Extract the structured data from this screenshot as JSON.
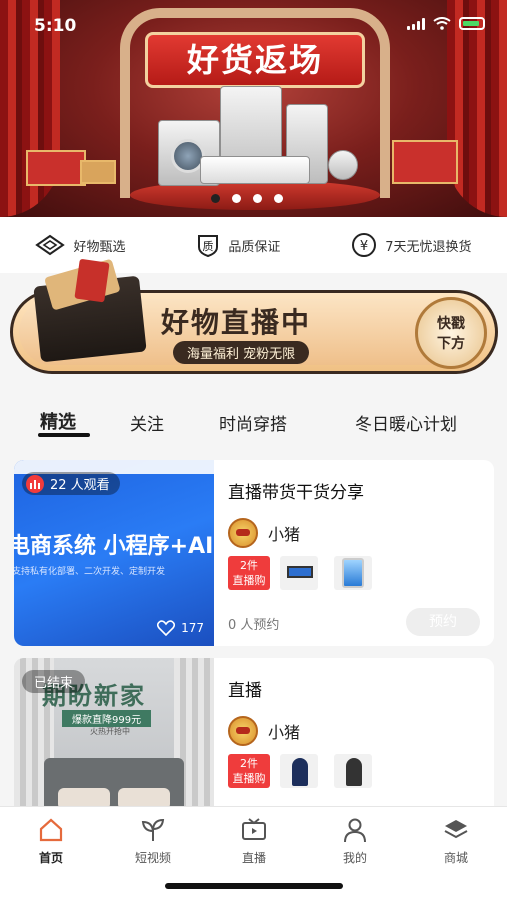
{
  "status_bar": {
    "time": "5:10"
  },
  "hero": {
    "title": "好货返场",
    "dots_total": 4,
    "dots_active_index": 0
  },
  "features": [
    {
      "icon": "diamond-icon",
      "label": "好物甄选"
    },
    {
      "icon": "shield-quality-icon",
      "icon_text": "质",
      "label": "品质保证"
    },
    {
      "icon": "yuan-circle-icon",
      "icon_text": "¥",
      "label": "7天无忧退换货"
    }
  ],
  "live_banner": {
    "title": "好物直播中",
    "subtitle": "海量福利 宠粉无限",
    "button": "快戳\n下方",
    "button_line1": "快戳",
    "button_line2": "下方"
  },
  "tabs": [
    {
      "label": "精选",
      "active": true
    },
    {
      "label": "关注",
      "active": false
    },
    {
      "label": "时尚穿搭",
      "active": false
    },
    {
      "label": "冬日暖心计划",
      "active": false
    }
  ],
  "cards": [
    {
      "title": "直播带货干货分享",
      "host": "小猪",
      "goods_tag_line1": "2件",
      "goods_tag_line2": "直播购",
      "viewers": "22 人观看",
      "likes": "177",
      "reserve_count": "0 人预约",
      "reserve_button": "预约",
      "thumb_text": "电商系统 小程序+AI",
      "thumb_small": "支持私有化部署、二次开发、定制开发"
    },
    {
      "title": "直播",
      "host": "小猪",
      "goods_tag_line1": "2件",
      "goods_tag_line2": "直播购",
      "status": "已结束",
      "thumb_title": "期盼新家",
      "thumb_sub": "爆款直降999元",
      "thumb_sub2": "火热开抢中"
    }
  ],
  "nav": [
    {
      "label": "首页",
      "icon": "home-icon",
      "active": true
    },
    {
      "label": "短视频",
      "icon": "sprout-icon",
      "active": false
    },
    {
      "label": "直播",
      "icon": "tv-icon",
      "active": false
    },
    {
      "label": "我的",
      "icon": "user-icon",
      "active": false
    },
    {
      "label": "商城",
      "icon": "layers-icon",
      "active": false
    }
  ],
  "colors": {
    "accent_red": "#ef3c3c",
    "banner_gold": "#efc08b",
    "nav_active": "#e56a3c"
  }
}
